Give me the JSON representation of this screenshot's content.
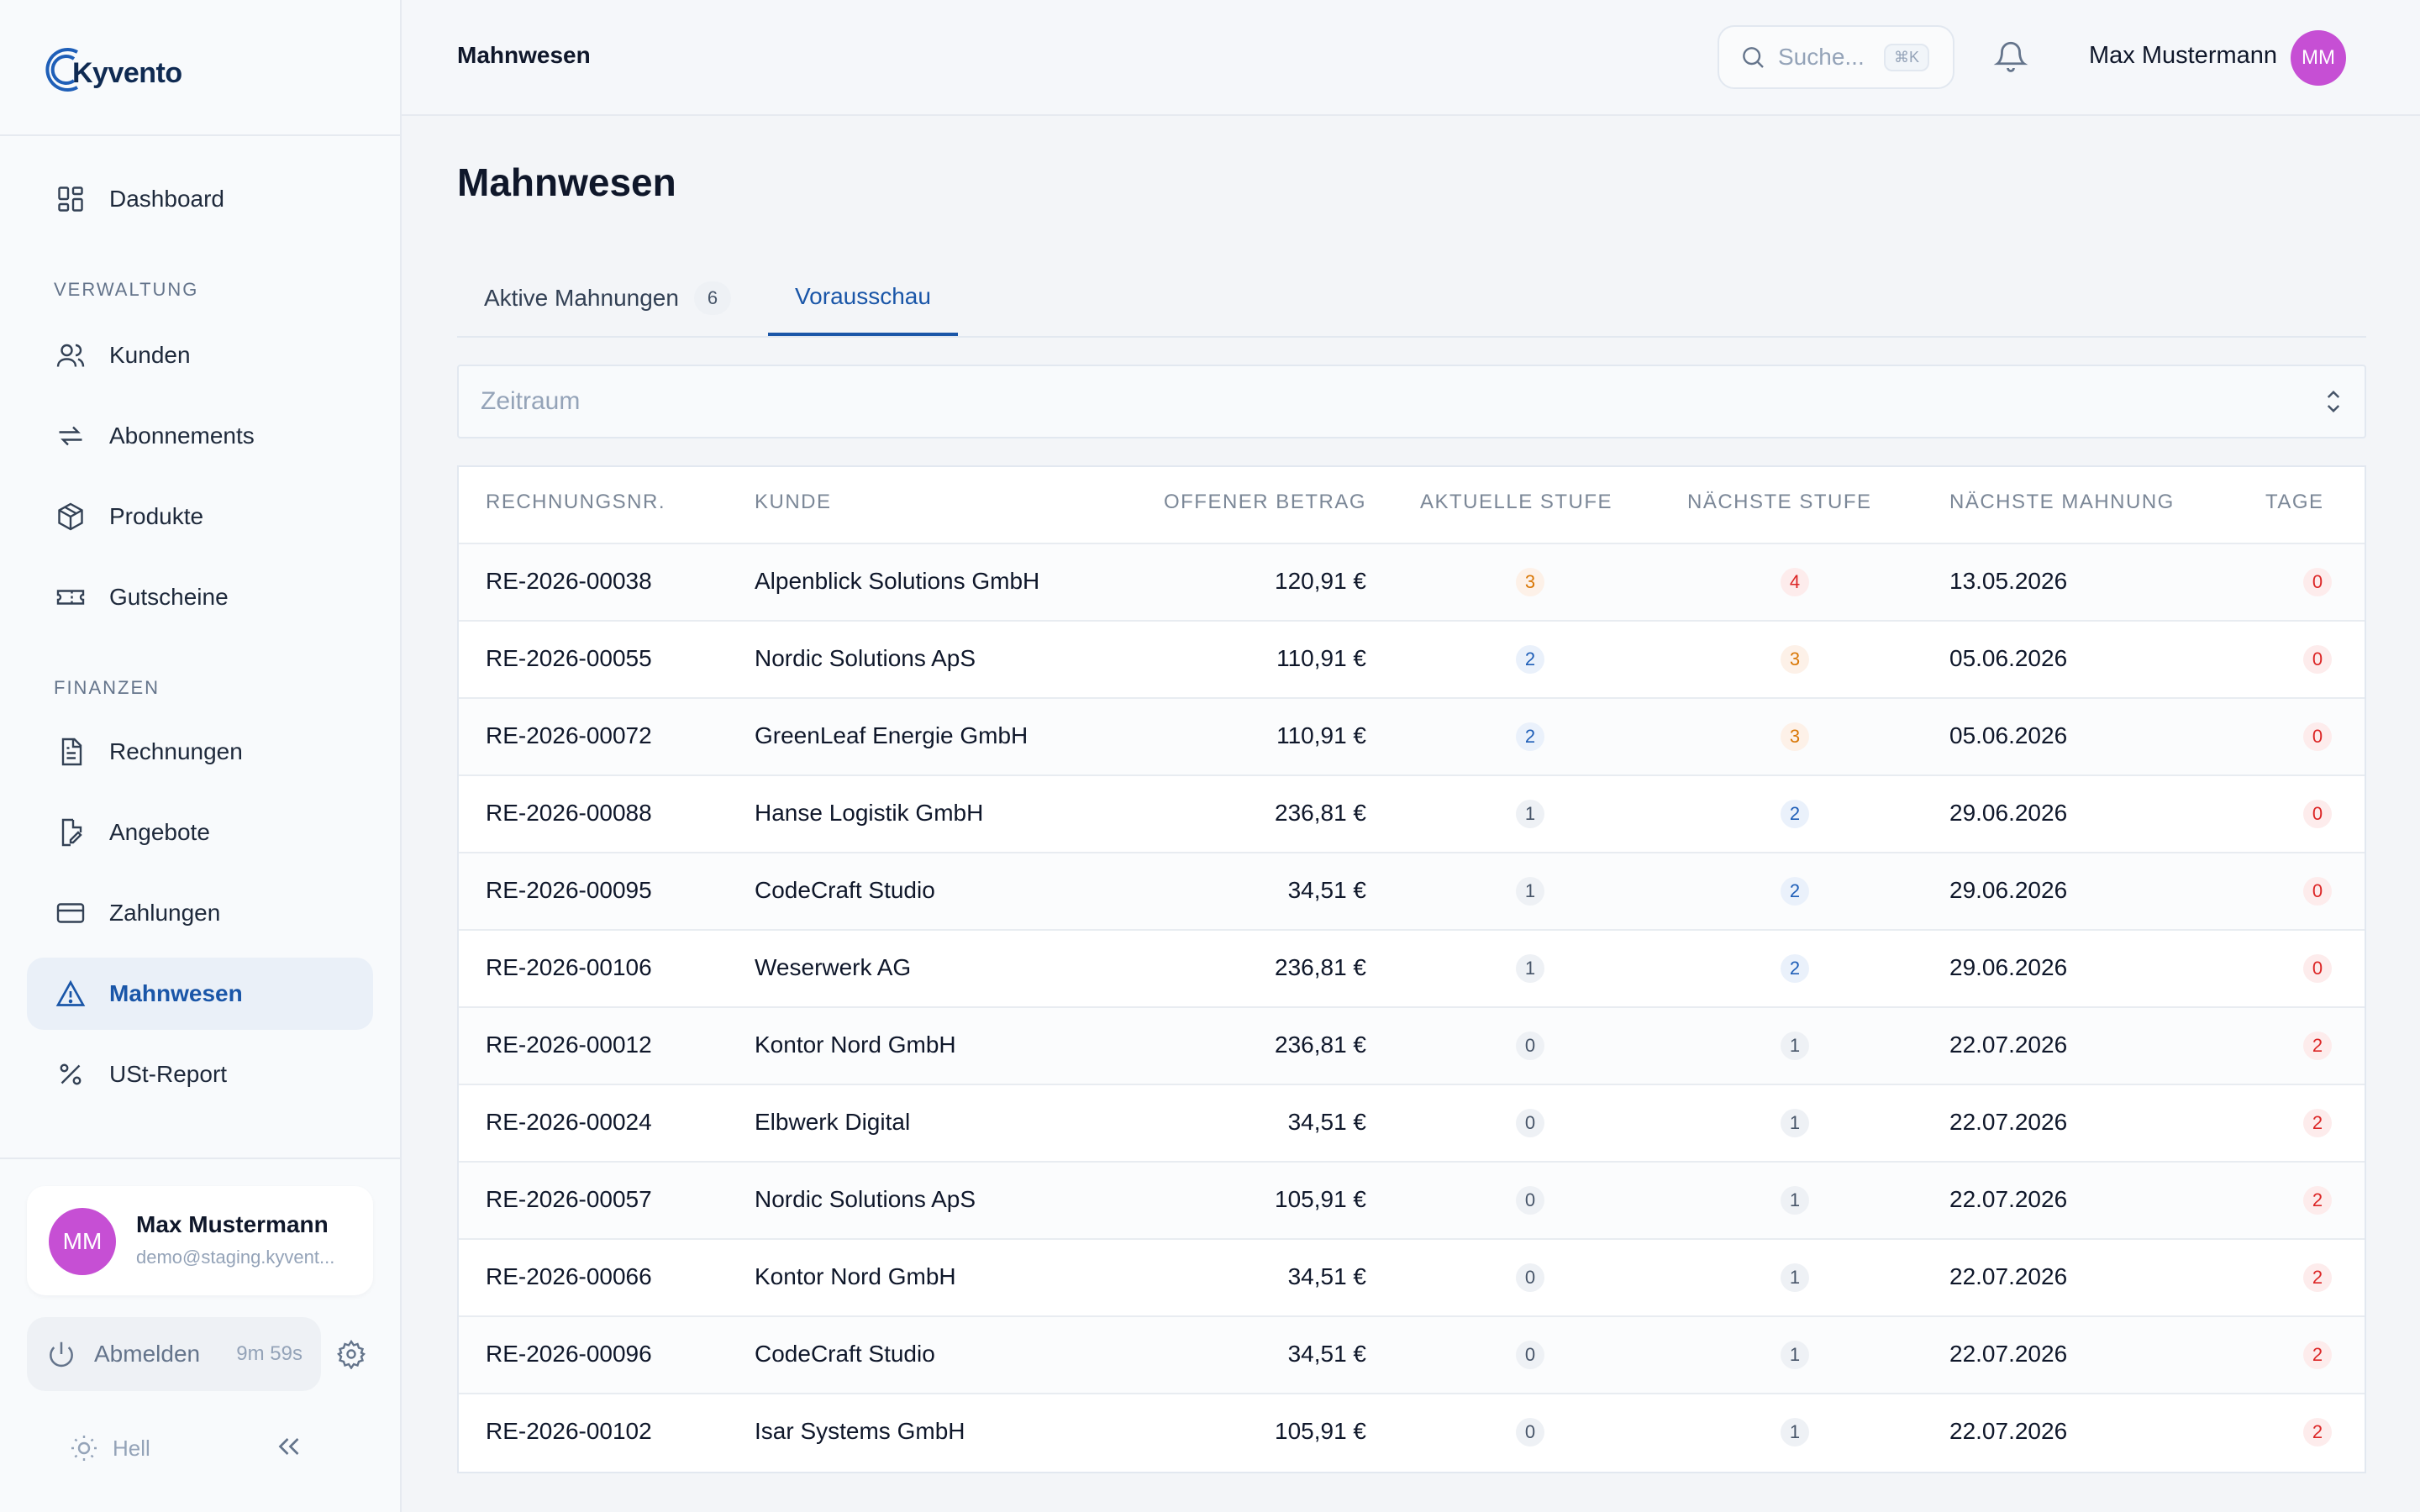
{
  "brand": {
    "name": "Kyvento"
  },
  "sidebar": {
    "dashboard": "Dashboard",
    "section_verwaltung": "VERWALTUNG",
    "kunden": "Kunden",
    "abonnements": "Abonnements",
    "produkte": "Produkte",
    "gutscheine": "Gutscheine",
    "section_finanzen": "FINANZEN",
    "rechnungen": "Rechnungen",
    "angebote": "Angebote",
    "zahlungen": "Zahlungen",
    "mahnwesen": "Mahnwesen",
    "ust_report": "USt-Report",
    "active_item": "Mahnwesen",
    "user": {
      "initials": "MM",
      "name": "Max Mustermann",
      "email": "demo@staging.kyvent..."
    },
    "logout_label": "Abmelden",
    "session_timer": "9m 59s",
    "theme_label": "Hell"
  },
  "header": {
    "title": "Mahnwesen",
    "search_placeholder": "Suche...",
    "search_shortcut": "⌘K",
    "user_name": "Max Mustermann",
    "user_initials": "MM"
  },
  "main": {
    "title": "Mahnwesen",
    "tabs": [
      {
        "label": "Aktive Mahnungen",
        "count": "6"
      },
      {
        "label": "Vorausschau"
      }
    ],
    "active_tab": "Vorausschau",
    "period_placeholder": "Zeitraum",
    "columns": {
      "invoice": "RECHNUNGSNR.",
      "customer": "KUNDE",
      "amount": "OFFENER BETRAG",
      "current": "AKTUELLE STUFE",
      "next": "NÄCHSTE STUFE",
      "next_date": "NÄCHSTE MAHNUNG",
      "days": "TAGE"
    },
    "rows": [
      {
        "invoice": "RE-2026-00038",
        "customer": "Alpenblick Solutions GmbH",
        "amount": "120,91 €",
        "current": "3",
        "next": "4",
        "next_date": "13.05.2026",
        "days": "0"
      },
      {
        "invoice": "RE-2026-00055",
        "customer": "Nordic Solutions ApS",
        "amount": "110,91 €",
        "current": "2",
        "next": "3",
        "next_date": "05.06.2026",
        "days": "0"
      },
      {
        "invoice": "RE-2026-00072",
        "customer": "GreenLeaf Energie GmbH",
        "amount": "110,91 €",
        "current": "2",
        "next": "3",
        "next_date": "05.06.2026",
        "days": "0"
      },
      {
        "invoice": "RE-2026-00088",
        "customer": "Hanse Logistik GmbH",
        "amount": "236,81 €",
        "current": "1",
        "next": "2",
        "next_date": "29.06.2026",
        "days": "0"
      },
      {
        "invoice": "RE-2026-00095",
        "customer": "CodeCraft Studio",
        "amount": "34,51 €",
        "current": "1",
        "next": "2",
        "next_date": "29.06.2026",
        "days": "0"
      },
      {
        "invoice": "RE-2026-00106",
        "customer": "Weserwerk AG",
        "amount": "236,81 €",
        "current": "1",
        "next": "2",
        "next_date": "29.06.2026",
        "days": "0"
      },
      {
        "invoice": "RE-2026-00012",
        "customer": "Kontor Nord GmbH",
        "amount": "236,81 €",
        "current": "0",
        "next": "1",
        "next_date": "22.07.2026",
        "days": "2"
      },
      {
        "invoice": "RE-2026-00024",
        "customer": "Elbwerk Digital",
        "amount": "34,51 €",
        "current": "0",
        "next": "1",
        "next_date": "22.07.2026",
        "days": "2"
      },
      {
        "invoice": "RE-2026-00057",
        "customer": "Nordic Solutions ApS",
        "amount": "105,91 €",
        "current": "0",
        "next": "1",
        "next_date": "22.07.2026",
        "days": "2"
      },
      {
        "invoice": "RE-2026-00066",
        "customer": "Kontor Nord GmbH",
        "amount": "34,51 €",
        "current": "0",
        "next": "1",
        "next_date": "22.07.2026",
        "days": "2"
      },
      {
        "invoice": "RE-2026-00096",
        "customer": "CodeCraft Studio",
        "amount": "34,51 €",
        "current": "0",
        "next": "1",
        "next_date": "22.07.2026",
        "days": "2"
      },
      {
        "invoice": "RE-2026-00102",
        "customer": "Isar Systems GmbH",
        "amount": "105,91 €",
        "current": "0",
        "next": "1",
        "next_date": "22.07.2026",
        "days": "2"
      }
    ]
  },
  "colors": {
    "accent": "#1a56a8",
    "avatar": "#c64fd4",
    "level_3": "#d97706",
    "level_4": "#dc2626",
    "level_2": "#1f5fb8",
    "level_1": "#475569",
    "days_red": "#dc2626"
  }
}
